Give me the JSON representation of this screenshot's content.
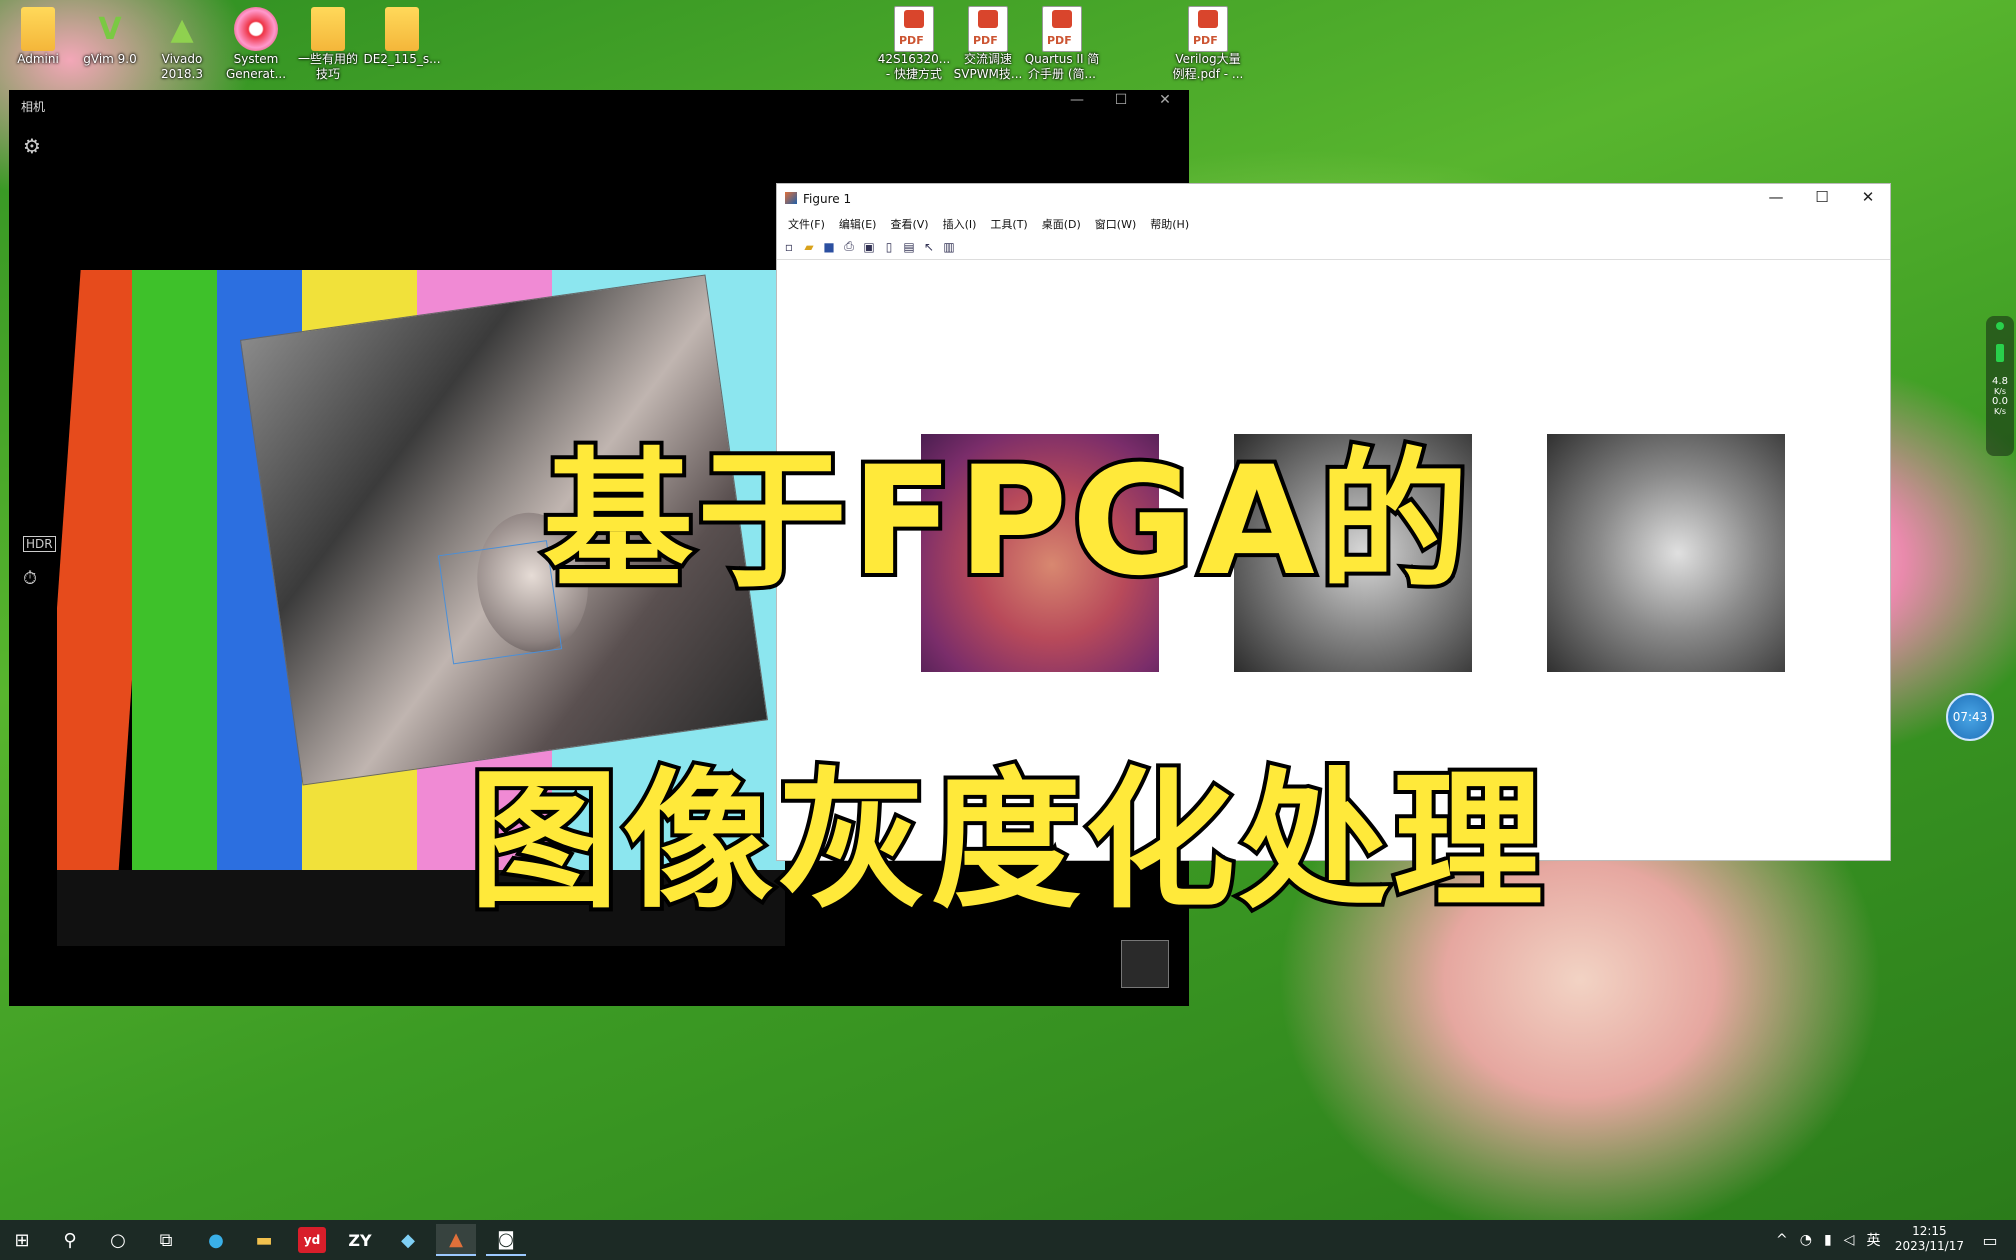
{
  "desktop": {
    "icons": [
      {
        "label": "Admini",
        "icon": "user-folder-icon"
      },
      {
        "label": "gVim 9.0",
        "icon": "gvim-icon"
      },
      {
        "label": "Vivado\n2018.3",
        "icon": "vivado-icon"
      },
      {
        "label": "System\nGenerat...",
        "icon": "system-generator-icon"
      },
      {
        "label": "一些有用的\n技巧",
        "icon": "document-icon"
      },
      {
        "label": "DE2_115_s...",
        "icon": "document-icon"
      },
      {
        "label": "42S16320...\n- 快捷方式",
        "icon": "pdf-icon"
      },
      {
        "label": "交流调速\nSVPWM技...",
        "icon": "pdf-icon"
      },
      {
        "label": "Quartus II 简\n介手册 (简...",
        "icon": "pdf-icon"
      },
      {
        "label": "Verilog大量\n例程.pdf - ...",
        "icon": "pdf-icon"
      }
    ]
  },
  "camera_window": {
    "title": "相机",
    "controls": {
      "minimize": "—",
      "maximize": "☐",
      "close": "✕"
    }
  },
  "figure_window": {
    "title": "Figure 1",
    "menu": [
      "文件(F)",
      "编辑(E)",
      "查看(V)",
      "插入(I)",
      "工具(T)",
      "桌面(D)",
      "窗口(W)",
      "帮助(H)"
    ],
    "controls": {
      "minimize": "—",
      "maximize": "☐",
      "close": "✕"
    },
    "images": [
      "color-lena",
      "grayscale-lena-1",
      "grayscale-lena-2"
    ]
  },
  "caption": {
    "line1": "基于FPGA的",
    "line2": "图像灰度化处理"
  },
  "widgets": {
    "timer": "07:43",
    "net_up": "4.8",
    "net_up_unit": "K/s",
    "net_down": "0.0",
    "net_down_unit": "K/s"
  },
  "taskbar": {
    "apps": [
      "start-icon",
      "search-icon",
      "cortana-icon",
      "task-view-icon",
      "edge-icon",
      "file-explorer-icon",
      "youdao-icon",
      "zy-icon",
      "store-icon",
      "matlab-icon",
      "camera-icon"
    ],
    "ime": "英",
    "time": "12:15",
    "date": "2023/11/17"
  },
  "colors": {
    "caption_fill": "#ffe93a",
    "caption_stroke": "#000000",
    "taskbar": "#1c2a25"
  }
}
